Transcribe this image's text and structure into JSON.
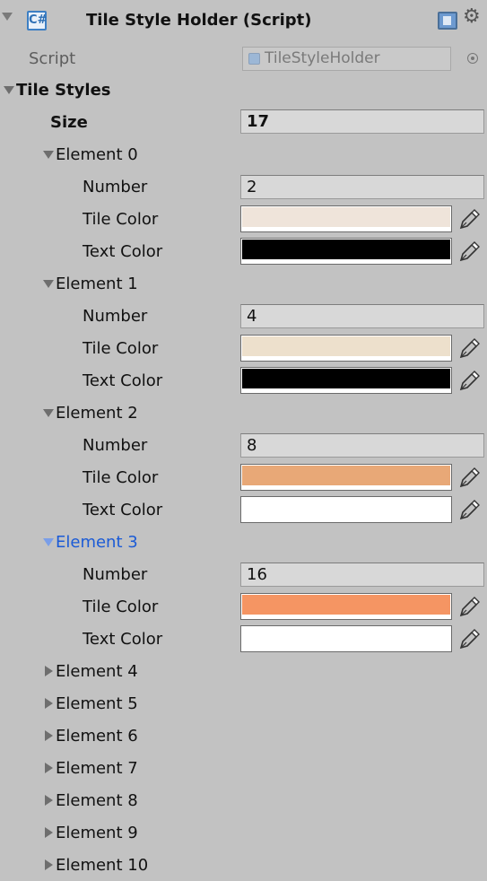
{
  "component": {
    "title": "Tile Style Holder (Script)",
    "script_label": "Script",
    "script_value": "TileStyleHolder",
    "script_icon_glyph": "C#"
  },
  "tile_styles": {
    "label": "Tile Styles",
    "size_label": "Size",
    "size_value": "17",
    "number_label": "Number",
    "tile_color_label": "Tile Color",
    "text_color_label": "Text Color",
    "elements": [
      {
        "label": "Element 0",
        "number": "2",
        "tile_color": "#efe4da",
        "text_color": "#000000"
      },
      {
        "label": "Element 1",
        "number": "4",
        "tile_color": "#ede0cc",
        "text_color": "#000000"
      },
      {
        "label": "Element 2",
        "number": "8",
        "tile_color": "#e8a877",
        "text_color": "#ffffff"
      },
      {
        "label": "Element 3",
        "number": "16",
        "tile_color": "#f59563",
        "text_color": "#ffffff"
      }
    ],
    "collapsed": [
      "Element 4",
      "Element 5",
      "Element 6",
      "Element 7",
      "Element 8",
      "Element 9",
      "Element 10"
    ]
  },
  "colors": {
    "background": "#c2c2c2",
    "selected_text": "#1b5bd6"
  }
}
